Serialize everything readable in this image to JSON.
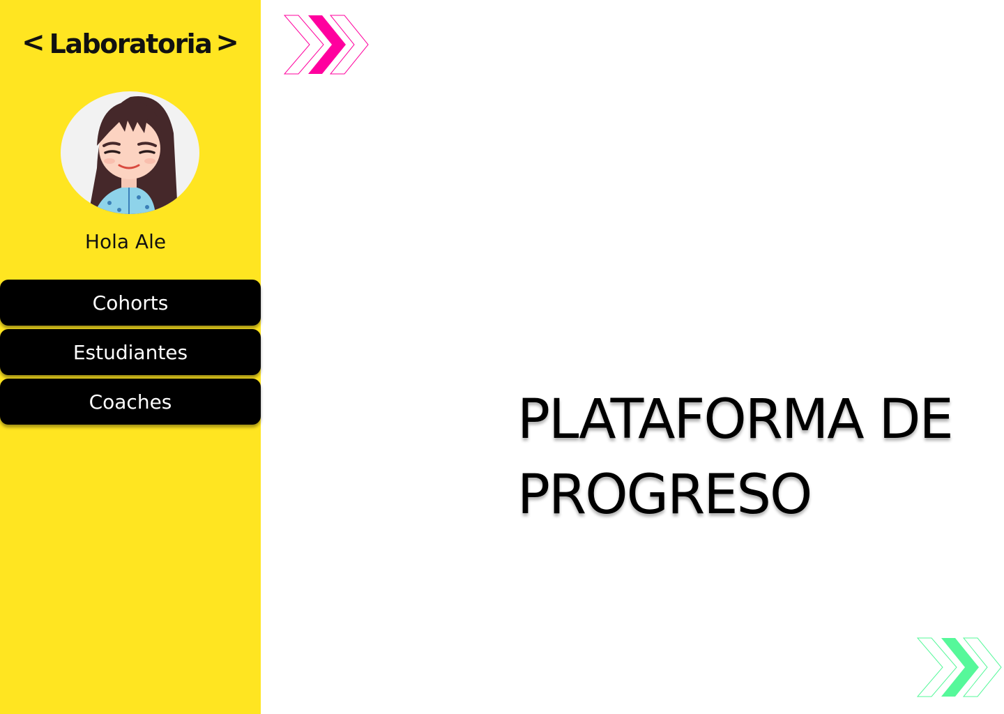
{
  "brand": {
    "left_bracket": "<",
    "name": "Laboratoria",
    "right_bracket": ">"
  },
  "user": {
    "greeting": "Hola Ale"
  },
  "nav": {
    "items": [
      {
        "label": "Cohorts"
      },
      {
        "label": "Estudiantes"
      },
      {
        "label": "Coaches"
      }
    ]
  },
  "main": {
    "title_line1": "PLATAFORMA DE",
    "title_line2": "PROGRESO"
  },
  "colors": {
    "sidebar": "#FFE521",
    "nav_button": "#000000",
    "chevron_top": "#FF009E",
    "chevron_bottom": "#56F89A"
  },
  "icons": {
    "top_decoration": "double-chevron-right-icon",
    "bottom_decoration": "double-chevron-right-icon",
    "avatar": "user-avatar-illustration"
  }
}
